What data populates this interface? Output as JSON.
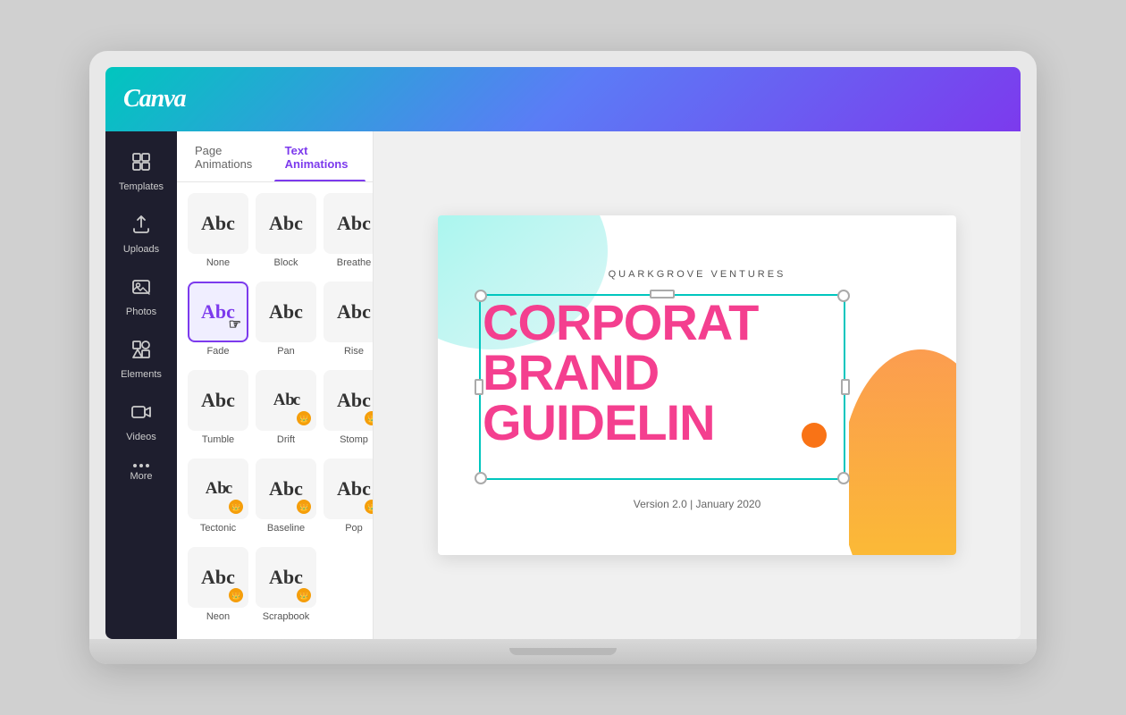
{
  "app": {
    "name": "Canva",
    "header_gradient": "linear-gradient(135deg, #00c6be 0%, #5b7cf6 50%, #7c3aed 100%)"
  },
  "sidebar": {
    "items": [
      {
        "id": "templates",
        "label": "Templates",
        "icon": "⊞"
      },
      {
        "id": "uploads",
        "label": "Uploads",
        "icon": "☁"
      },
      {
        "id": "photos",
        "label": "Photos",
        "icon": "🖼"
      },
      {
        "id": "elements",
        "label": "Elements",
        "icon": "◈"
      },
      {
        "id": "videos",
        "label": "Videos",
        "icon": "▶"
      },
      {
        "id": "more",
        "label": "More",
        "icon": "···"
      }
    ]
  },
  "panel": {
    "tabs": [
      {
        "id": "page-animations",
        "label": "Page Animations",
        "active": false
      },
      {
        "id": "text-animations",
        "label": "Text Animations",
        "active": true
      }
    ],
    "animations": [
      {
        "id": "none",
        "label": "None",
        "text": "Abc",
        "selected": false,
        "premium": false,
        "cursor": false
      },
      {
        "id": "block",
        "label": "Block",
        "text": "Abc",
        "selected": false,
        "premium": false,
        "cursor": false
      },
      {
        "id": "breathe",
        "label": "Breathe",
        "text": "Abc",
        "selected": false,
        "premium": false,
        "cursor": false
      },
      {
        "id": "fade",
        "label": "Fade",
        "text": "Abc",
        "selected": true,
        "premium": false,
        "cursor": true
      },
      {
        "id": "pan",
        "label": "Pan",
        "text": "Abc",
        "selected": false,
        "premium": false,
        "cursor": false
      },
      {
        "id": "rise",
        "label": "Rise",
        "text": "Abc",
        "selected": false,
        "premium": false,
        "cursor": false
      },
      {
        "id": "tumble",
        "label": "Tumble",
        "text": "Abc",
        "selected": false,
        "premium": false,
        "cursor": false
      },
      {
        "id": "drift",
        "label": "Drift",
        "text": "A bc",
        "selected": false,
        "premium": true,
        "cursor": false
      },
      {
        "id": "stomp",
        "label": "Stomp",
        "text": "Abc",
        "selected": false,
        "premium": true,
        "cursor": false
      },
      {
        "id": "tectonic",
        "label": "Tectonic",
        "text": "A bc",
        "selected": false,
        "premium": true,
        "cursor": false
      },
      {
        "id": "baseline",
        "label": "Baseline",
        "text": "Abc",
        "selected": false,
        "premium": true,
        "cursor": false
      },
      {
        "id": "pop",
        "label": "Pop",
        "text": "Abc",
        "selected": false,
        "premium": true,
        "cursor": false
      },
      {
        "id": "neon",
        "label": "Neon",
        "text": "Abc",
        "selected": false,
        "premium": true,
        "cursor": false
      },
      {
        "id": "scrapbook",
        "label": "Scrapbook",
        "text": "Abc",
        "selected": false,
        "premium": true,
        "cursor": false
      }
    ]
  },
  "canvas": {
    "company": "QUARKGROVE VENTURES",
    "headline": "CORPORAT\nBRAND\nGUIDELIN",
    "version": "Version 2.0 | January 2020"
  }
}
